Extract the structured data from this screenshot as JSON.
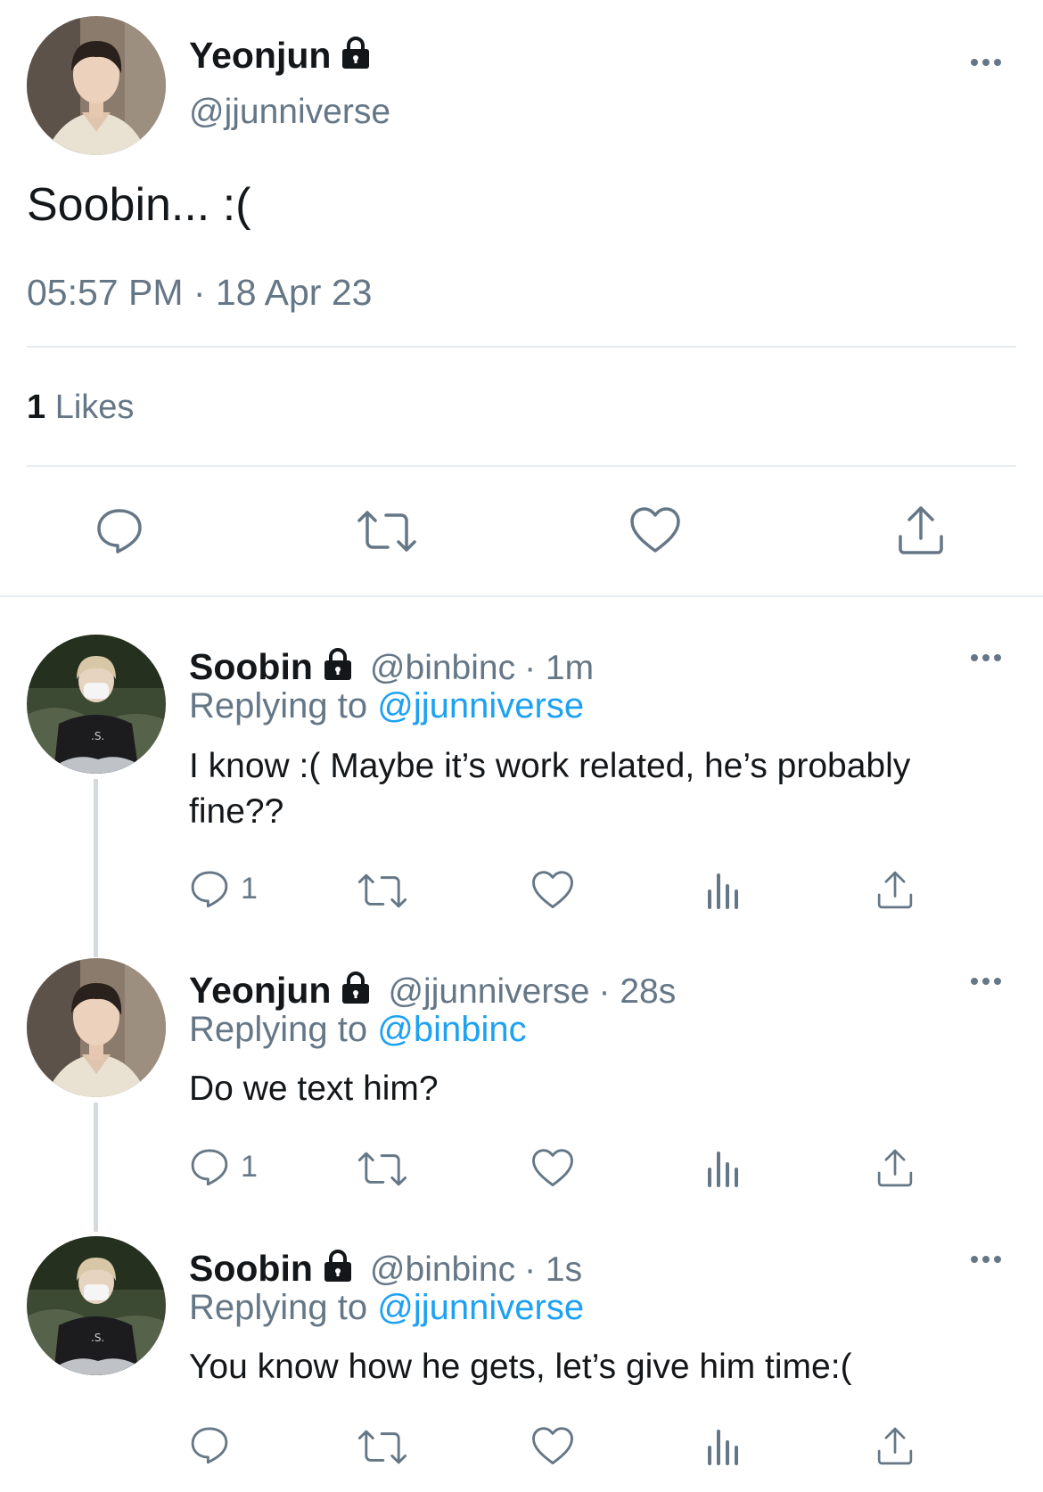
{
  "main_tweet": {
    "display_name": "Yeonjun",
    "handle": "@jjunniverse",
    "text": "Soobin... :(",
    "timestamp": "05:57 PM · 18 Apr 23",
    "likes_count": "1",
    "likes_label": "Likes",
    "icons": [
      "comment-icon",
      "retweet-icon",
      "heart-icon",
      "share-icon"
    ]
  },
  "replies": [
    {
      "display_name": "Soobin",
      "handle": "@binbinc",
      "time": "· 1m",
      "replying_label": "Replying to",
      "replying_to": "@jjunniverse",
      "text": "I know :( Maybe it’s work related, he’s probably fine??",
      "reply_count": "1"
    },
    {
      "display_name": "Yeonjun",
      "handle": "@jjunniverse",
      "time": "· 28s",
      "replying_label": "Replying to",
      "replying_to": "@binbinc",
      "text": "Do we text him?",
      "reply_count": "1"
    },
    {
      "display_name": "Soobin",
      "handle": "@binbinc",
      "time": "· 1s",
      "replying_label": "Replying to",
      "replying_to": "@jjunniverse",
      "text": "You know how he gets, let’s give him time:(",
      "reply_count": ""
    }
  ],
  "colors": {
    "text": "#14171a",
    "secondary": "#657786",
    "link": "#1da1f2",
    "divider": "#e6ecf0"
  }
}
